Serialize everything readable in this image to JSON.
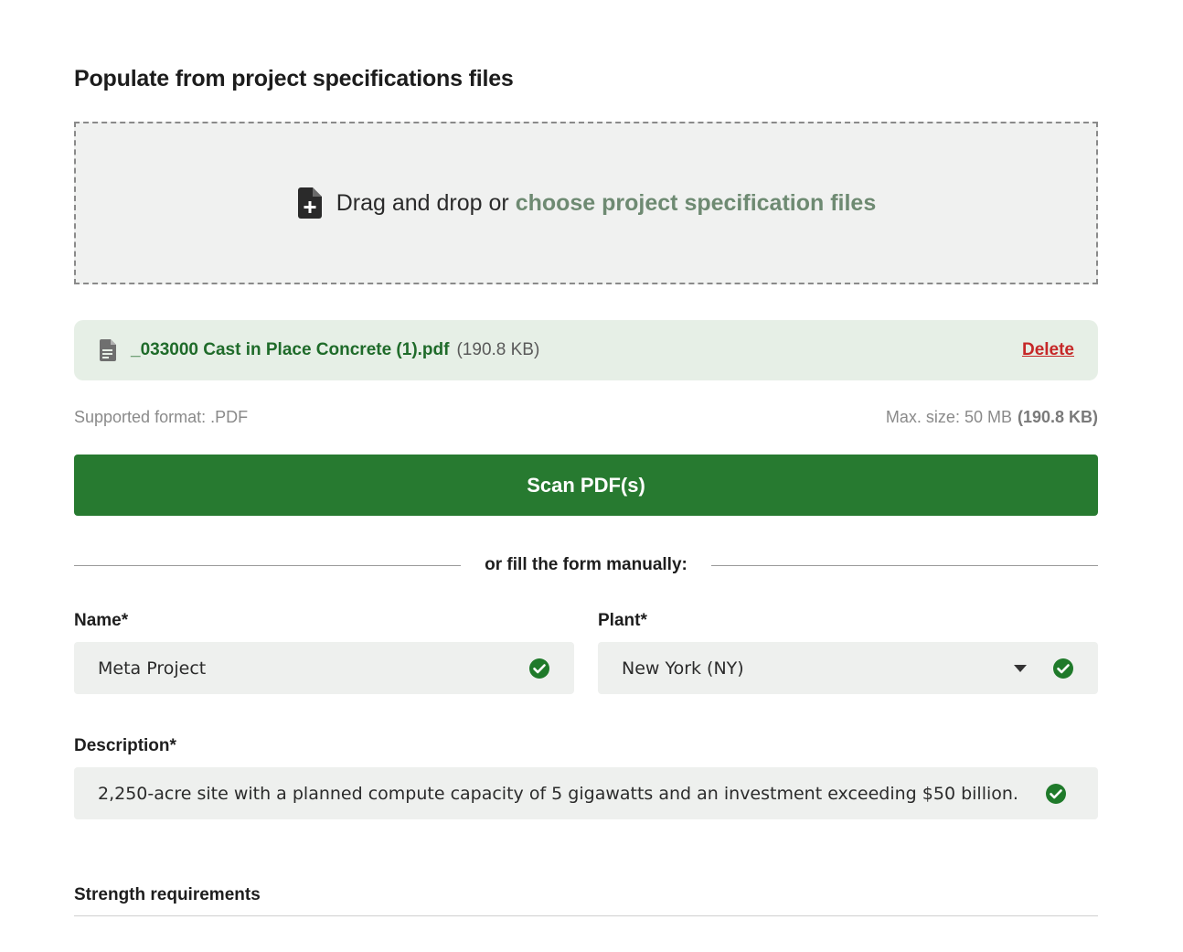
{
  "upload": {
    "title": "Populate from project specifications files",
    "dropzone_prefix": "Drag and drop or ",
    "dropzone_link": "choose project specification files",
    "file": {
      "name": "_033000 Cast in Place Concrete (1).pdf",
      "size": "(190.8 KB)",
      "delete_label": "Delete"
    },
    "supported_format": "Supported format: .PDF",
    "max_size_label": "Max. size: 50 MB",
    "max_size_current": "(190.8 KB)",
    "scan_button": "Scan PDF(s)"
  },
  "divider": {
    "text": "or fill the form manually:"
  },
  "form": {
    "name": {
      "label": "Name*",
      "value": "Meta Project"
    },
    "plant": {
      "label": "Plant*",
      "value": "New York (NY)"
    },
    "description": {
      "label": "Description*",
      "value": "2,250-acre site with a planned compute capacity of 5 gigawatts and an investment exceeding $50 billion."
    }
  },
  "strength": {
    "title": "Strength requirements"
  },
  "colors": {
    "primary_green": "#277a30",
    "link_green": "#6e8a72",
    "delete_red": "#c62828",
    "check_green": "#1f7a2a"
  },
  "icons": {
    "dropzone": "file-add-icon",
    "file": "document-icon",
    "valid": "check-circle-icon",
    "select": "caret-down-icon"
  }
}
